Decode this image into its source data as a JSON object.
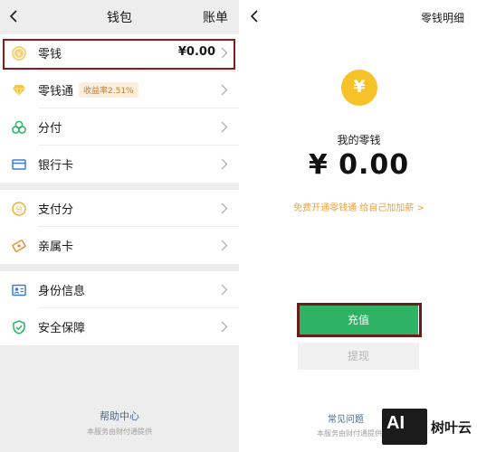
{
  "wallet": {
    "title": "钱包",
    "right_action": "账单",
    "groups": [
      {
        "items": [
          {
            "label": "零钱",
            "value": "¥0.00",
            "icon": "coin-icon"
          },
          {
            "label": "零钱通",
            "badge": "收益率2.51%",
            "icon": "diamond-icon"
          },
          {
            "label": "分付",
            "icon": "fenfu-icon"
          },
          {
            "label": "银行卡",
            "icon": "bank-card-icon"
          }
        ]
      },
      {
        "items": [
          {
            "label": "支付分",
            "icon": "pay-score-icon"
          },
          {
            "label": "亲属卡",
            "icon": "family-card-icon"
          }
        ]
      },
      {
        "items": [
          {
            "label": "身份信息",
            "icon": "id-card-icon"
          },
          {
            "label": "安全保障",
            "icon": "shield-icon"
          }
        ]
      }
    ],
    "footer_link": "帮助中心",
    "footer_note": "本服务由财付通提供"
  },
  "change": {
    "title": "零钱明细",
    "coin_symbol": "¥",
    "label": "我的零钱",
    "balance": "¥ 0.00",
    "promo": "免费开通零钱通 给自己加加薪 >",
    "recharge_label": "充值",
    "withdraw_label": "提现",
    "faq_label": "常见问题",
    "footer_note": "本服务由财付通提供"
  },
  "watermark": {
    "logo_text": "AI",
    "brand": "树叶云"
  },
  "colors": {
    "accent_green": "#2eb264",
    "coin_yellow": "#f6c228",
    "promo_orange": "#e9a33d",
    "highlight_red": "#8b1a1a",
    "link_blue": "#4a6a90"
  }
}
